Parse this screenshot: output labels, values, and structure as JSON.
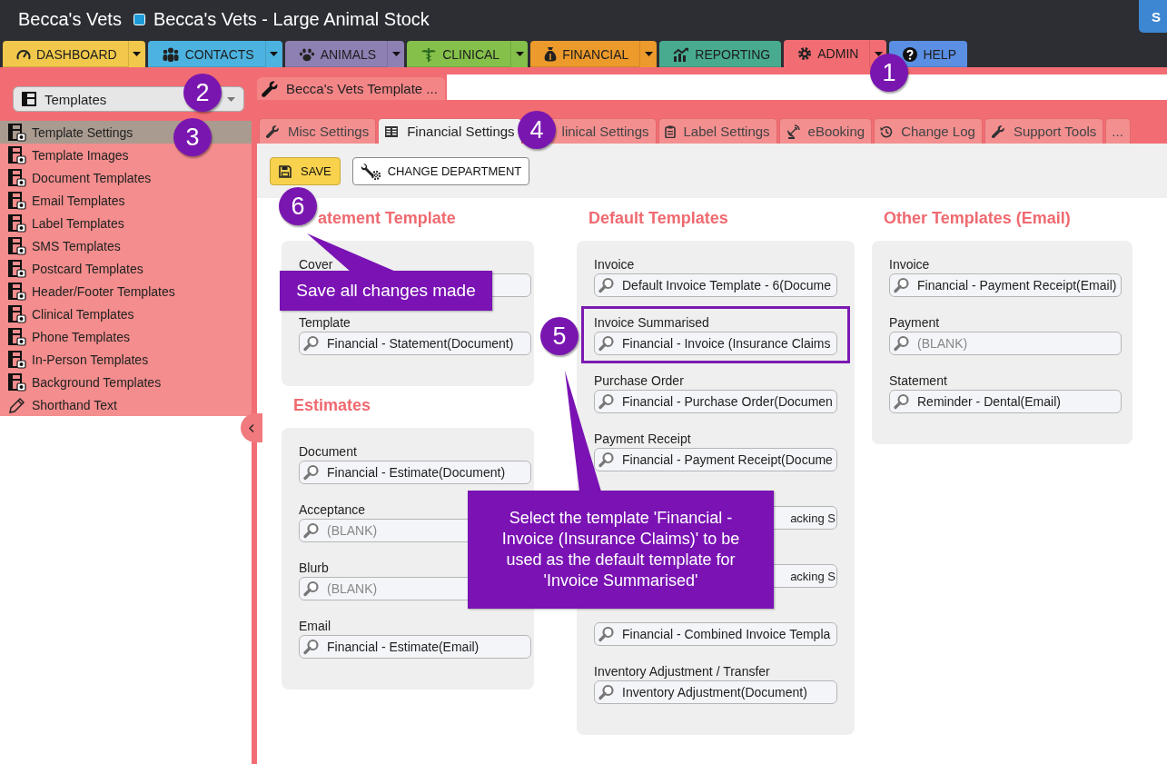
{
  "window": {
    "title": "Becca's Vets",
    "subtitle": "Becca's Vets - Large Animal Stock",
    "corner_button": "S"
  },
  "nav_tabs": [
    {
      "label": "DASHBOARD",
      "color": "#f1c84b",
      "has_menu": true,
      "selected": false
    },
    {
      "label": "CONTACTS",
      "color": "#4cb3e0",
      "has_menu": true,
      "selected": false
    },
    {
      "label": "ANIMALS",
      "color": "#8f80b3",
      "has_menu": true,
      "selected": false
    },
    {
      "label": "CLINICAL",
      "color": "#84c04a",
      "has_menu": true,
      "selected": false
    },
    {
      "label": "FINANCIAL",
      "color": "#ec9a2c",
      "has_menu": true,
      "selected": false
    },
    {
      "label": "REPORTING",
      "color": "#48ab90",
      "has_menu": false,
      "selected": false
    },
    {
      "label": "ADMIN",
      "color": "#f26d73",
      "has_menu": true,
      "selected": true
    },
    {
      "label": "HELP",
      "color": "#5a8fe3",
      "has_menu": false,
      "selected": false
    }
  ],
  "sidebar": {
    "dropdown": "Templates",
    "items": [
      {
        "label": "Template Settings",
        "selected": true
      },
      {
        "label": "Template Images",
        "selected": false
      },
      {
        "label": "Document Templates",
        "selected": false
      },
      {
        "label": "Email Templates",
        "selected": false
      },
      {
        "label": "Label Templates",
        "selected": false
      },
      {
        "label": "SMS Templates",
        "selected": false
      },
      {
        "label": "Postcard Templates",
        "selected": false
      },
      {
        "label": "Header/Footer Templates",
        "selected": false
      },
      {
        "label": "Clinical Templates",
        "selected": false
      },
      {
        "label": "Phone Templates",
        "selected": false
      },
      {
        "label": "In-Person Templates",
        "selected": false
      },
      {
        "label": "Background Templates",
        "selected": false
      },
      {
        "label": "Shorthand Text",
        "selected": false
      }
    ]
  },
  "document_tab": {
    "label": "Becca's Vets Template ..."
  },
  "settings_tabs": [
    {
      "label": "Misc Settings",
      "selected": false
    },
    {
      "label": "Financial Settings",
      "selected": true
    },
    {
      "label": "linical Settings",
      "selected": false
    },
    {
      "label": "Label Settings",
      "selected": false
    },
    {
      "label": "eBooking",
      "selected": false
    },
    {
      "label": "Change Log",
      "selected": false
    },
    {
      "label": "Support Tools",
      "selected": false
    },
    {
      "label": "...",
      "selected": false
    }
  ],
  "toolbar": [
    {
      "label": "SAVE",
      "kind": "save"
    },
    {
      "label": "CHANGE DEPARTMENT",
      "kind": "department"
    }
  ],
  "columns": [
    {
      "sections": [
        {
          "title": "atement Template",
          "fields": [
            {
              "label": "Cover",
              "highlighted": false
            },
            {
              "label": "Template",
              "value": "Financial - Statement(Document)",
              "highlighted": false
            }
          ]
        },
        {
          "title": "Estimates",
          "fields": [
            {
              "label": "Document",
              "value": "Financial - Estimate(Document)",
              "highlighted": false
            },
            {
              "label": "Acceptance",
              "placeholder": "(BLANK)",
              "highlighted": false
            },
            {
              "label": "Blurb",
              "placeholder": "(BLANK)",
              "highlighted": false
            },
            {
              "label": "Email",
              "value": "Financial - Estimate(Email)",
              "highlighted": false
            }
          ]
        }
      ]
    },
    {
      "sections": [
        {
          "title": "Default Templates",
          "fields": [
            {
              "kind": "lookup",
              "label": "Invoice",
              "value": "Default Invoice Template - 6(Docume",
              "highlighted": false
            },
            {
              "kind": "lookup",
              "label": "Invoice Summarised",
              "value": "Financial - Invoice (Insurance Claims",
              "highlighted": true
            },
            {
              "kind": "lookup",
              "label": "Purchase Order",
              "value": "Financial - Purchase Order(Documen",
              "highlighted": false
            },
            {
              "kind": "lookup",
              "label": "Payment Receipt",
              "value": "Financial - Payment Receipt(Docume",
              "highlighted": false
            },
            {
              "kind": "cut",
              "value": "acking S",
              "highlighted": false
            },
            {
              "kind": "cut",
              "value": "acking S",
              "highlighted": false
            },
            {
              "kind": "lookup",
              "value": "Financial - Combined Invoice Templa",
              "highlighted": false
            },
            {
              "kind": "lookup",
              "label": "Inventory Adjustment / Transfer",
              "value": "Inventory Adjustment(Document)",
              "highlighted": false
            }
          ]
        }
      ]
    },
    {
      "sections": [
        {
          "title": "Other Templates (Email)",
          "fields": [
            {
              "label": "Invoice",
              "value": "Financial - Payment Receipt(Email)",
              "highlighted": false
            },
            {
              "label": "Payment",
              "placeholder": "(BLANK)",
              "highlighted": false
            },
            {
              "label": "Statement",
              "value": "Reminder - Dental(Email)",
              "highlighted": false
            }
          ]
        }
      ]
    }
  ],
  "annotations": {
    "markers": [
      "1",
      "2",
      "3",
      "4",
      "5",
      "6"
    ],
    "callouts": [
      {
        "text": "Save all changes made"
      },
      {
        "text": "Select the template 'Financial - Invoice (Insurance Claims)' to be used as the default template for 'Invoice Summarised'"
      }
    ]
  }
}
